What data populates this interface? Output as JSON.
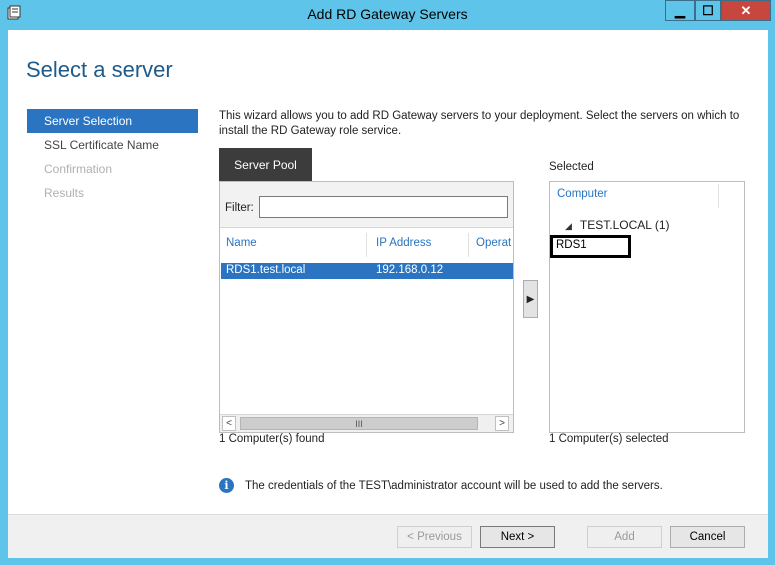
{
  "window": {
    "title": "Add RD Gateway Servers",
    "controls": {
      "minimize": "▁",
      "maximize": "☐",
      "close": "✕"
    }
  },
  "page": {
    "title": "Select a server"
  },
  "nav": {
    "items": [
      {
        "label": "Server Selection",
        "state": "active"
      },
      {
        "label": "SSL Certificate Name",
        "state": "normal"
      },
      {
        "label": "Confirmation",
        "state": "disabled"
      },
      {
        "label": "Results",
        "state": "disabled"
      }
    ]
  },
  "description": "This wizard allows you to add RD Gateway servers to your deployment. Select the servers on which to install the RD Gateway role service.",
  "server_pool": {
    "tab_label": "Server Pool",
    "filter_label": "Filter:",
    "filter_value": "",
    "columns": [
      "Name",
      "IP Address",
      "Operat"
    ],
    "rows": [
      {
        "name": "RDS1.test.local",
        "ip": "192.168.0.12",
        "os": "",
        "selected": true
      }
    ],
    "scroll_left": "<",
    "scroll_right": ">",
    "scroll_thumb": "III",
    "found_text": "1 Computer(s) found"
  },
  "add_arrow": "▶",
  "selected": {
    "label": "Selected",
    "column": "Computer",
    "group_toggle": "◢",
    "group": "TEST.LOCAL (1)",
    "items": [
      "RDS1"
    ],
    "count_text": "1 Computer(s) selected"
  },
  "info": {
    "icon": "i",
    "text": "The credentials of the TEST\\administrator account will be used to add the servers."
  },
  "buttons": {
    "previous": "< Previous",
    "next": "Next >",
    "add": "Add",
    "cancel": "Cancel"
  },
  "colors": {
    "accent": "#2a74c1",
    "frame": "#5fc4ea",
    "close": "#c7463d"
  }
}
